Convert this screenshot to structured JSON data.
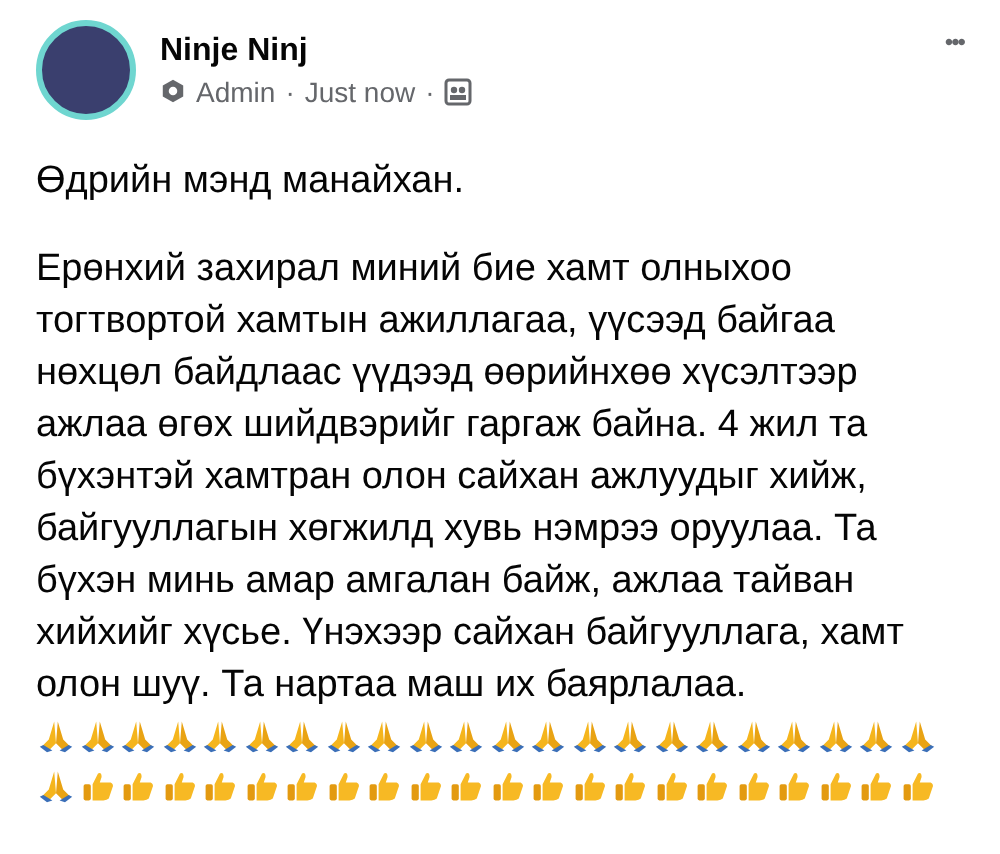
{
  "post": {
    "author": "Ninje Ninj",
    "role": "Admin",
    "separator_1": "·",
    "time": "Just now",
    "separator_2": "·",
    "more": "•••",
    "greeting": "Өдрийн мэнд манайхан.",
    "body": "Ерөнхий захирал миний бие хамт олныхоо тогтвортой хамтын ажиллагаа, үүсээд байгаа нөхцөл байдлаас үүдээд өөрийнхөө хүсэлтээр ажлаа өгөх шийдвэрийг гаргаж байна. 4 жил та бүхэнтэй хамтран олон сайхан ажлуудыг хийж, байгууллагын хөгжилд хувь нэмрээ оруулаа. Та бүхэн минь амар амгалан байж, ажлаа тайван хийхийг хүсье. Үнэхээр сайхан байгууллага, хамт олон шуү. Та нартаа маш их баярлалаа.",
    "emoji": [
      {
        "kind": "pray"
      },
      {
        "kind": "pray"
      },
      {
        "kind": "pray"
      },
      {
        "kind": "pray"
      },
      {
        "kind": "pray"
      },
      {
        "kind": "pray"
      },
      {
        "kind": "pray"
      },
      {
        "kind": "pray"
      },
      {
        "kind": "pray"
      },
      {
        "kind": "pray"
      },
      {
        "kind": "pray"
      },
      {
        "kind": "pray"
      },
      {
        "kind": "pray"
      },
      {
        "kind": "pray"
      },
      {
        "kind": "pray"
      },
      {
        "kind": "pray"
      },
      {
        "kind": "pray"
      },
      {
        "kind": "pray"
      },
      {
        "kind": "pray"
      },
      {
        "kind": "pray"
      },
      {
        "kind": "pray"
      },
      {
        "kind": "pray"
      },
      {
        "kind": "pray"
      },
      {
        "kind": "thumb"
      },
      {
        "kind": "thumb"
      },
      {
        "kind": "thumb"
      },
      {
        "kind": "thumb"
      },
      {
        "kind": "thumb"
      },
      {
        "kind": "thumb"
      },
      {
        "kind": "thumb"
      },
      {
        "kind": "thumb"
      },
      {
        "kind": "thumb"
      },
      {
        "kind": "thumb"
      },
      {
        "kind": "thumb"
      },
      {
        "kind": "thumb"
      },
      {
        "kind": "thumb"
      },
      {
        "kind": "thumb"
      },
      {
        "kind": "thumb"
      },
      {
        "kind": "thumb"
      },
      {
        "kind": "thumb"
      },
      {
        "kind": "thumb"
      },
      {
        "kind": "thumb"
      },
      {
        "kind": "thumb"
      },
      {
        "kind": "thumb"
      }
    ]
  }
}
